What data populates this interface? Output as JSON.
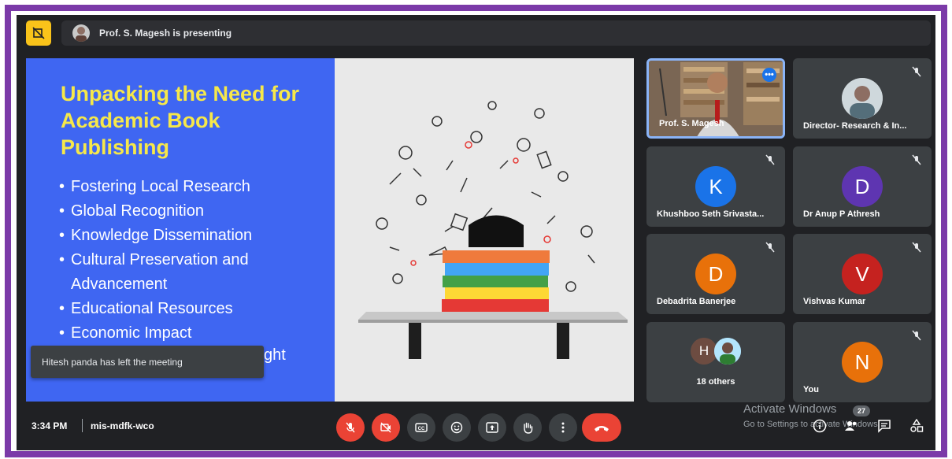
{
  "header": {
    "presenter_text": "Prof. S. Magesh is presenting"
  },
  "slide": {
    "title": "Unpacking the Need for Academic Book Publishing",
    "bullets": [
      "Fostering Local Research",
      "Global Recognition",
      "Knowledge Dissemination",
      "Cultural Preservation and Advancement",
      "Educational Resources",
      "Economic Impact"
    ],
    "partial_bullet_tail": "ght"
  },
  "notification": {
    "text": "Hitesh panda has left the meeting"
  },
  "participants": [
    {
      "name": "Prof. S. Magesh",
      "type": "video",
      "active": true
    },
    {
      "name": "Director- Research & In...",
      "type": "photo"
    },
    {
      "name": "Khushboo Seth Srivasta...",
      "initial": "K",
      "color": "#1a73e8"
    },
    {
      "name": "Dr Anup P Athresh",
      "initial": "D",
      "color": "#5e35b1"
    },
    {
      "name": "Debadrita Banerjee",
      "initial": "D",
      "color": "#e8710a"
    },
    {
      "name": "Vishvas Kumar",
      "initial": "V",
      "color": "#c5221f"
    },
    {
      "name": "18 others",
      "initial": "H",
      "color": "#6d4c41"
    },
    {
      "name": "You",
      "initial": "N",
      "color": "#e8710a"
    }
  ],
  "footer": {
    "time": "3:34 PM",
    "meeting_code": "mis-mdfk-wco",
    "watermark_title": "Activate Windows",
    "watermark_sub": "Go to Settings to activate Windows.",
    "people_count": "27"
  },
  "colors": {
    "accent": "#8ab4f8",
    "danger": "#ea4335",
    "slide_blue": "#3f66f2",
    "slide_title": "#f6e84a",
    "frame": "#7b3aa8"
  }
}
